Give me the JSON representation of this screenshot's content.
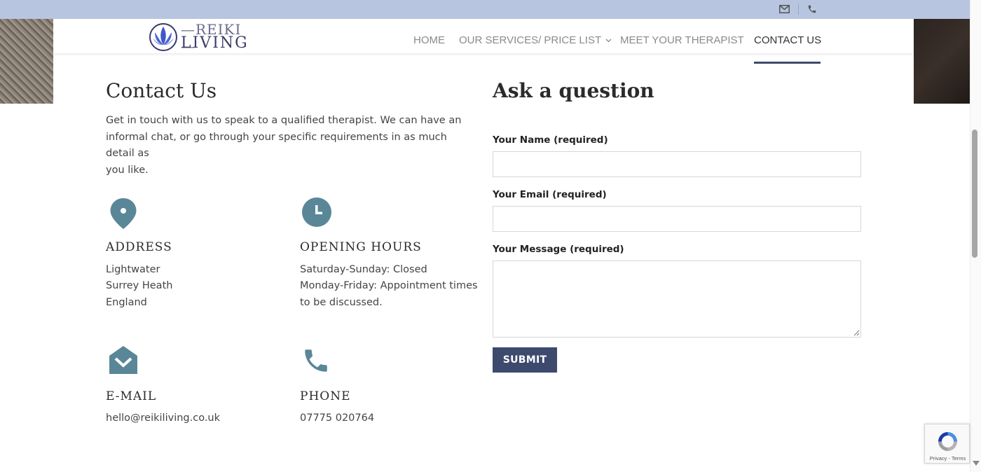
{
  "colors": {
    "topbar": "#b7c5e0",
    "accent": "#3d4a6e",
    "icon_teal": "#5a8797",
    "nav_text": "#8a8a8a"
  },
  "topbar": {
    "icons": [
      "mail-icon",
      "phone-icon"
    ]
  },
  "logo": {
    "line1": "—REIKI—",
    "line2": "LIVING",
    "icon": "lotus-icon"
  },
  "nav": {
    "items": [
      {
        "label": "HOME"
      },
      {
        "label": "OUR SERVICES/ PRICE LIST"
      },
      {
        "label": "MEET YOUR THERAPIST"
      },
      {
        "label": "CONTACT US",
        "active": true
      }
    ],
    "dropdown_icon": "chevron-down-icon"
  },
  "contact": {
    "title": "Contact Us",
    "intro_lines": [
      "Get in touch with us to speak to a qualified therapist. We can have an",
      "informal chat, or go through your specific requirements in as much detail as",
      "you like."
    ],
    "address": {
      "title": "ADDRESS",
      "lines": [
        "Lightwater",
        "Surrey Heath",
        "England"
      ],
      "icon": "map-pin-icon"
    },
    "hours": {
      "title": "OPENING HOURS",
      "lines": [
        "Saturday-Sunday: Closed",
        "Monday-Friday: Appointment times",
        "to be discussed."
      ],
      "icon": "clock-icon"
    },
    "email": {
      "title": "E-MAIL",
      "value": "hello@reikiliving.co.uk",
      "icon": "envelope-icon"
    },
    "phone": {
      "title": "PHONE",
      "value": "07775 020764",
      "icon": "phone-icon"
    }
  },
  "form": {
    "title": "Ask a question",
    "name_label": "Your Name (required)",
    "name_value": "",
    "email_label": "Your Email (required)",
    "email_value": "",
    "message_label": "Your Message (required)",
    "message_value": "",
    "submit_label": "SUBMIT"
  },
  "recaptcha": {
    "text": "Privacy - Terms",
    "icon": "recaptcha-icon"
  }
}
